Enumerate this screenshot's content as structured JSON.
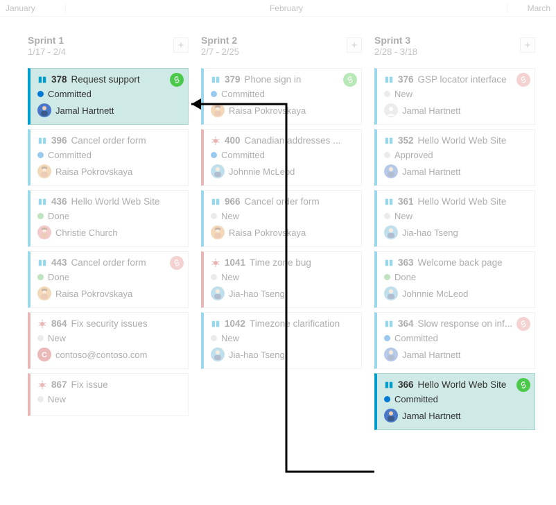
{
  "months": {
    "jan": "January",
    "feb": "February",
    "mar": "March"
  },
  "columns": [
    {
      "name": "Sprint 1",
      "dates": "1/17 - 2/4",
      "cards": [
        {
          "type": "pbi",
          "id": "378",
          "title": "Request support",
          "state": "Committed",
          "stateClass": "dot-committed",
          "assignee": "Jamal Hartnett",
          "avatar": "jh1",
          "link": "green",
          "highlight": true
        },
        {
          "type": "pbi",
          "id": "396",
          "title": "Cancel order form",
          "state": "Committed",
          "stateClass": "dot-committed",
          "assignee": "Raisa Pokrovskaya",
          "avatar": "rp"
        },
        {
          "type": "pbi",
          "id": "436",
          "title": "Hello World Web Site",
          "state": "Done",
          "stateClass": "dot-done",
          "assignee": "Christie Church",
          "avatar": "cc"
        },
        {
          "type": "pbi",
          "id": "443",
          "title": "Cancel order form",
          "state": "Done",
          "stateClass": "dot-done",
          "assignee": "Raisa Pokrovskaya",
          "avatar": "rp",
          "link": "red"
        },
        {
          "type": "bug",
          "id": "864",
          "title": "Fix security issues",
          "state": "New",
          "stateClass": "dot-new",
          "assignee": "contoso@contoso.com",
          "avatar": "co"
        },
        {
          "type": "bug",
          "id": "867",
          "title": "Fix issue",
          "state": "New",
          "stateClass": "dot-new",
          "assignee": "",
          "avatar": ""
        }
      ]
    },
    {
      "name": "Sprint 2",
      "dates": "2/7 - 2/25",
      "cards": [
        {
          "type": "pbi",
          "id": "379",
          "title": "Phone sign in",
          "state": "Committed",
          "stateClass": "dot-committed",
          "assignee": "Raisa Pokrovskaya",
          "avatar": "rp",
          "link": "green"
        },
        {
          "type": "bug",
          "id": "400",
          "title": "Canadian addresses ...",
          "state": "Committed",
          "stateClass": "dot-committed",
          "assignee": "Johnnie McLeod",
          "avatar": "jm"
        },
        {
          "type": "pbi",
          "id": "966",
          "title": "Cancel order form",
          "state": "New",
          "stateClass": "dot-new",
          "assignee": "Raisa Pokrovskaya",
          "avatar": "rp"
        },
        {
          "type": "bug",
          "id": "1041",
          "title": "Time zone bug",
          "state": "New",
          "stateClass": "dot-new",
          "assignee": "Jia-hao Tseng",
          "avatar": "jt"
        },
        {
          "type": "pbi",
          "id": "1042",
          "title": "Timezone clarification",
          "state": "New",
          "stateClass": "dot-new",
          "assignee": "Jia-hao Tseng",
          "avatar": "jt"
        }
      ]
    },
    {
      "name": "Sprint 3",
      "dates": "2/28 - 3/18",
      "cards": [
        {
          "type": "pbi",
          "id": "376",
          "title": "GSP locator interface",
          "state": "New",
          "stateClass": "dot-new",
          "assignee": "Jamal Hartnett",
          "avatar": "jh2",
          "link": "red"
        },
        {
          "type": "pbi",
          "id": "352",
          "title": "Hello World Web Site",
          "state": "Approved",
          "stateClass": "dot-approved",
          "assignee": "Jamal Hartnett",
          "avatar": "jh1"
        },
        {
          "type": "pbi",
          "id": "361",
          "title": "Hello World Web Site",
          "state": "New",
          "stateClass": "dot-new",
          "assignee": "Jia-hao Tseng",
          "avatar": "jt"
        },
        {
          "type": "pbi",
          "id": "363",
          "title": "Welcome back page",
          "state": "Done",
          "stateClass": "dot-done",
          "assignee": "Johnnie McLeod",
          "avatar": "jm"
        },
        {
          "type": "pbi",
          "id": "364",
          "title": "Slow response on inf...",
          "state": "Committed",
          "stateClass": "dot-committed",
          "assignee": "Jamal Hartnett",
          "avatar": "jh1",
          "link": "red"
        },
        {
          "type": "pbi",
          "id": "366",
          "title": "Hello World Web Site",
          "state": "Committed",
          "stateClass": "dot-committed",
          "assignee": "Jamal Hartnett",
          "avatar": "jh1",
          "link": "green",
          "highlight": true
        }
      ]
    }
  ]
}
